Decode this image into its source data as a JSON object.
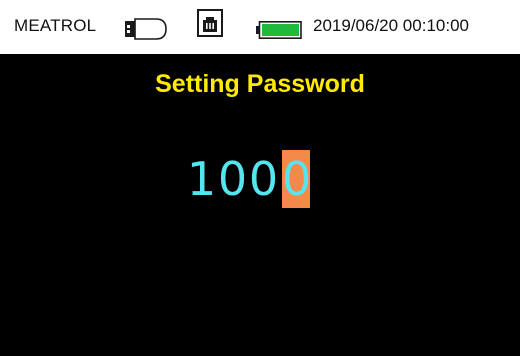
{
  "status_bar": {
    "brand": "MEATROL",
    "datetime": "2019/06/20 00:10:00",
    "icons": [
      "usb-drive-icon",
      "ethernet-port-icon",
      "battery-icon"
    ],
    "battery_level": 1.0,
    "battery_color": "#1fba3a"
  },
  "screen": {
    "title": "Setting Password",
    "title_color": "#ffea00",
    "password_digits": [
      "1",
      "0",
      "0",
      "0"
    ],
    "active_digit_index": 3,
    "digit_color": "#55e5ee",
    "cursor_color": "#f4894a"
  }
}
